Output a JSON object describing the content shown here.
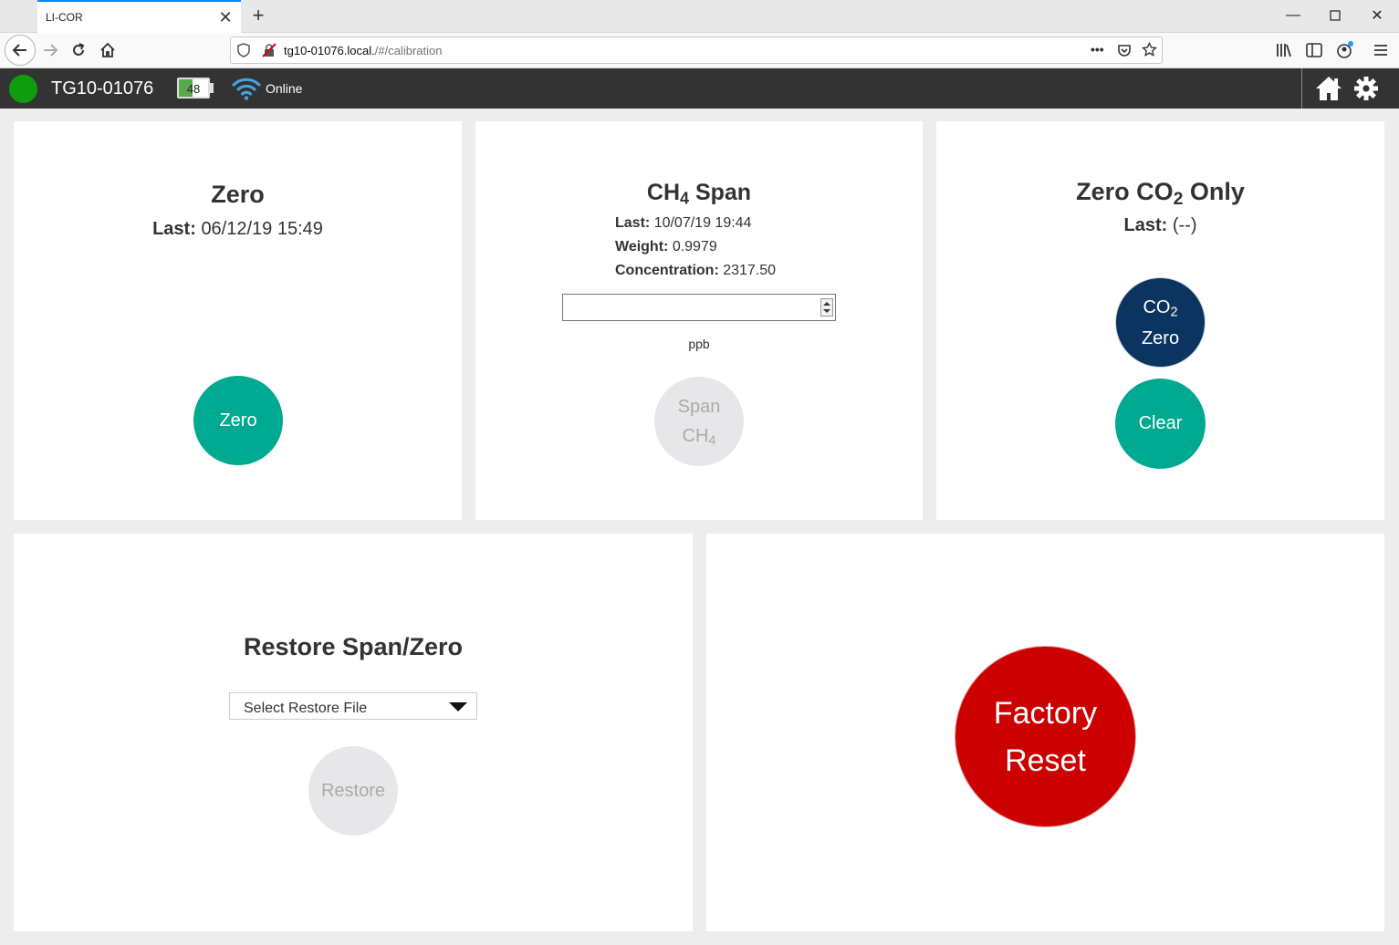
{
  "browser": {
    "tab_title": "LI-COR",
    "url_host": "tg10-01076.local.",
    "url_path": "/#/calibration"
  },
  "header": {
    "device_name": "TG10-01076",
    "battery_level": 48,
    "battery_text": "48",
    "connection_status": "Online",
    "status_color": "#0f9d0f"
  },
  "zero_panel": {
    "title": "Zero",
    "last_label": "Last:",
    "last_value": "06/12/19 15:49",
    "button_label": "Zero"
  },
  "ch4_panel": {
    "title_prefix": "CH",
    "title_sub": "4",
    "title_suffix": " Span",
    "last_label": "Last:",
    "last_value": "10/07/19 19:44",
    "weight_label": "Weight:",
    "weight_value": "0.9979",
    "concentration_label": "Concentration:",
    "concentration_value": "2317.50",
    "input_value": "",
    "unit": "ppb",
    "button_line1": "Span",
    "button_line2_prefix": "CH",
    "button_line2_sub": "4"
  },
  "co2_panel": {
    "title_prefix": "Zero CO",
    "title_sub": "2",
    "title_suffix": " Only",
    "last_label": "Last:",
    "last_value": "(--)",
    "co2_button_prefix": "CO",
    "co2_button_sub": "2",
    "co2_button_line2": "Zero",
    "clear_button": "Clear"
  },
  "restore_panel": {
    "title": "Restore Span/Zero",
    "select_value": "Select Restore File",
    "button_label": "Restore"
  },
  "factory_panel": {
    "button_line1": "Factory",
    "button_line2": "Reset"
  },
  "colors": {
    "teal": "#00a991",
    "navy": "#0b3460",
    "red": "#cc0000",
    "disabled": "#e7e7e9",
    "header": "#333333"
  }
}
